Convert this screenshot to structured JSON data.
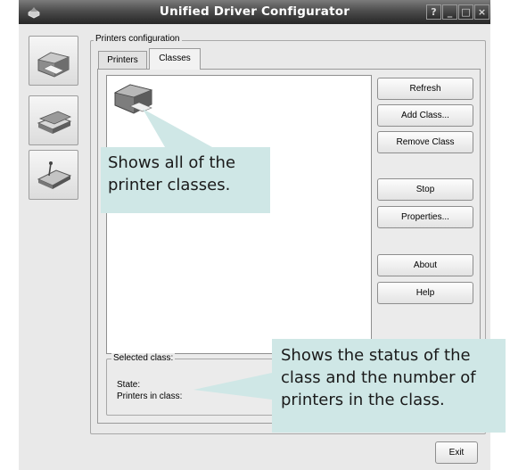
{
  "window": {
    "title": "Unified Driver Configurator",
    "controls": {
      "help": "?",
      "minimize": "_",
      "maximize": "□",
      "close": "×"
    }
  },
  "sidebar": {
    "items": [
      {
        "id": "printers",
        "icon": "printer-icon"
      },
      {
        "id": "scanners",
        "icon": "scanner-icon"
      },
      {
        "id": "ports",
        "icon": "port-icon"
      }
    ]
  },
  "group": {
    "label": "Printers configuration",
    "tabs": [
      {
        "label": "Printers",
        "active": false
      },
      {
        "label": "Classes",
        "active": true
      }
    ]
  },
  "buttons": {
    "refresh": "Refresh",
    "add_class": "Add Class...",
    "remove_class": "Remove Class",
    "stop": "Stop",
    "properties": "Properties...",
    "about": "About",
    "help": "Help"
  },
  "selected_class": {
    "label": "Selected class:",
    "state_label": "State:",
    "printers_label": "Printers in class:"
  },
  "exit_label": "Exit",
  "callouts": {
    "classes_line1": "Shows all of the",
    "classes_line2": "printer classes.",
    "status_line1": "Shows the status of the",
    "status_line2": "class and the number of",
    "status_line3": "printers in the class."
  },
  "colors": {
    "callout": "#cfe7e6",
    "titlebar": "#4d4d4d",
    "window": "#e9e9e9"
  }
}
